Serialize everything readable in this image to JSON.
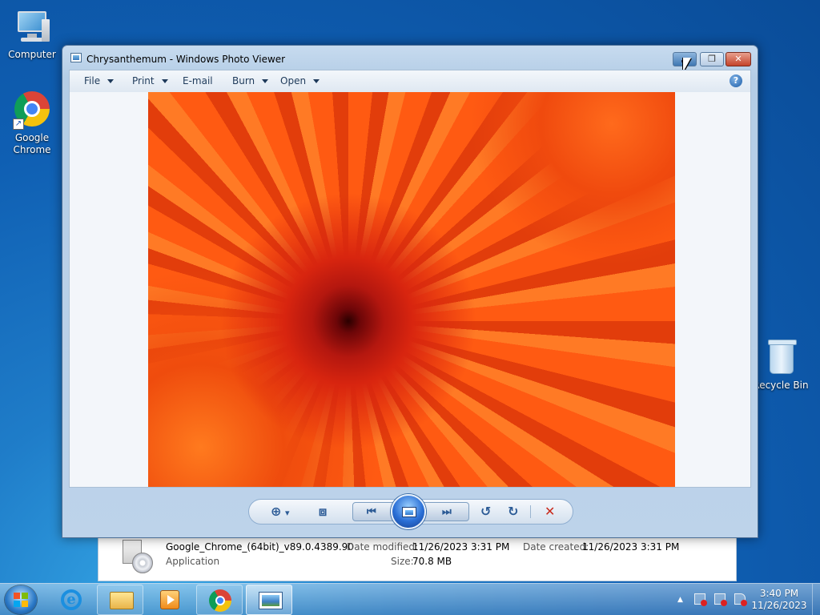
{
  "desktop": {
    "icons": [
      {
        "label": "Computer"
      },
      {
        "label": "Google Chrome"
      },
      {
        "label": "Recycle Bin"
      }
    ]
  },
  "window": {
    "title": "Chrysanthemum - Windows Photo Viewer",
    "menu": [
      {
        "label": "File"
      },
      {
        "label": "Print"
      },
      {
        "label": "E-mail"
      },
      {
        "label": "Burn"
      },
      {
        "label": "Open"
      }
    ],
    "help": "?",
    "buttons": {
      "close": "✕",
      "maximize": "❐"
    }
  },
  "toolbar": {
    "zoom": "⊕",
    "zoom_arrow": "▾",
    "actual_size": "⧈",
    "previous": "⏮",
    "next": "⏭",
    "rotate_ccw": "↺",
    "rotate_cw": "↻",
    "delete": "✕"
  },
  "explorer": {
    "file_name": "Google_Chrome_(64bit)_v89.0.4389.90",
    "file_type": "Application",
    "date_modified_label": "Date modified:",
    "date_modified": "11/26/2023 3:31 PM",
    "date_created_label": "Date created:",
    "date_created": "11/26/2023 3:31 PM",
    "size_label": "Size:",
    "size": "70.8 MB"
  },
  "taskbar": {
    "items": [
      "internet-explorer",
      "file-explorer",
      "media-player",
      "google-chrome",
      "photo-viewer"
    ],
    "tray_arrow": "▲",
    "clock_time": "3:40 PM",
    "clock_date": "11/26/2023"
  },
  "colors": {
    "desktop_blue": "#0f5fb3",
    "window_frame": "#b4cde6",
    "close_red": "#c4432b",
    "photo_orange": "#f05012"
  }
}
